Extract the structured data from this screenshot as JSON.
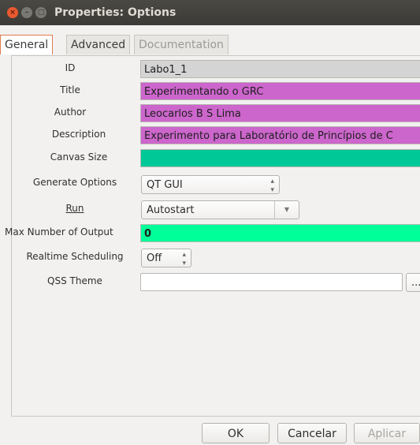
{
  "window": {
    "title": "Properties: Options"
  },
  "tabs": [
    {
      "label": "General",
      "state": "active"
    },
    {
      "label": "Advanced",
      "state": "normal"
    },
    {
      "label": "Documentation",
      "state": "disabled"
    }
  ],
  "form": {
    "id": {
      "label": "ID",
      "value": "Labo1_1"
    },
    "title": {
      "label": "Title",
      "value": "Experimentando o GRC"
    },
    "author": {
      "label": "Author",
      "value": "Leocarlos B S Lima"
    },
    "description": {
      "label": "Description",
      "value": "Experimento para Laboratório de Princípios de C"
    },
    "canvas_size": {
      "label": "Canvas Size",
      "value": ""
    },
    "generate_options": {
      "label": "Generate Options",
      "value": "QT GUI"
    },
    "run": {
      "label": "Run",
      "value": "Autostart"
    },
    "max_output": {
      "label": "Max Number of Output",
      "value": "0"
    },
    "realtime": {
      "label": "Realtime Scheduling",
      "value": "Off"
    },
    "qss_theme": {
      "label": "QSS Theme",
      "value": "",
      "browse_label": "..."
    }
  },
  "buttons": {
    "ok": "OK",
    "cancel": "Cancelar",
    "apply": "Aplicar"
  },
  "colors": {
    "id_field": "#d4d4d4",
    "title_field": "#cc66cc",
    "author_field": "#cc66cc",
    "description_field": "#cc66cc",
    "canvas_field": "#00c896",
    "max_output_field": "#00ff99",
    "active_tab_border": "#e27a4e"
  }
}
